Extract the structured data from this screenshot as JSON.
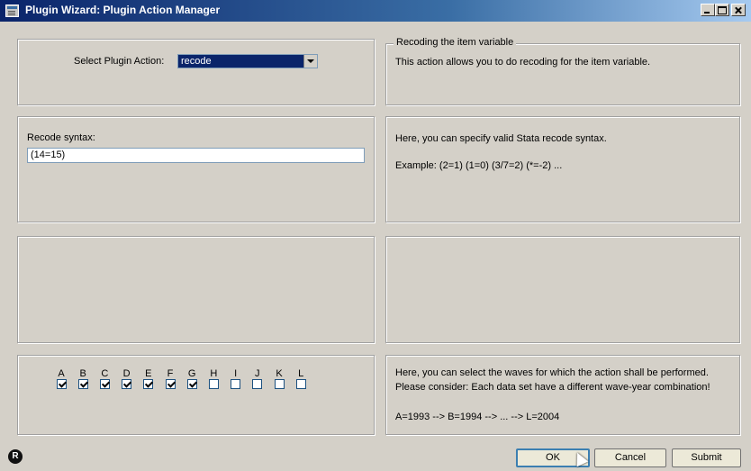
{
  "window": {
    "title": "Plugin Wizard: Plugin Action Manager"
  },
  "action_panel": {
    "select_label": "Select Plugin Action:",
    "selected_action": "recode"
  },
  "info_panel_1": {
    "legend": "Recoding the item variable",
    "text": "This action allows you to do recoding for the item variable."
  },
  "syntax_panel": {
    "label": "Recode syntax:",
    "value": "(14=15)"
  },
  "info_panel_2": {
    "line1": "Here, you can specify valid Stata recode syntax.",
    "line2": "Example: (2=1) (1=0) (3/7=2) (*=-2) ..."
  },
  "waves": [
    {
      "letter": "A",
      "checked": true
    },
    {
      "letter": "B",
      "checked": true
    },
    {
      "letter": "C",
      "checked": true
    },
    {
      "letter": "D",
      "checked": true
    },
    {
      "letter": "E",
      "checked": true
    },
    {
      "letter": "F",
      "checked": true
    },
    {
      "letter": "G",
      "checked": true
    },
    {
      "letter": "H",
      "checked": false
    },
    {
      "letter": "I",
      "checked": false
    },
    {
      "letter": "J",
      "checked": false
    },
    {
      "letter": "K",
      "checked": false
    },
    {
      "letter": "L",
      "checked": false
    }
  ],
  "info_panel_4": {
    "line1": "Here, you can select the waves for which the action shall be performed.",
    "line2": "Please consider: Each data set have a different wave-year combination!",
    "line3": "A=1993 --> B=1994 --> ... --> L=2004"
  },
  "buttons": {
    "ok": "OK",
    "cancel": "Cancel",
    "submit": "Submit"
  },
  "status": {
    "r_icon": "R"
  },
  "icons": {
    "app": "window-app-icon",
    "r": "r-logo-icon",
    "cursor": "mouse-cursor-icon"
  },
  "colors": {
    "titlebar": "#0a246a",
    "selection": "#0a246a",
    "face": "#d4d0c8"
  }
}
